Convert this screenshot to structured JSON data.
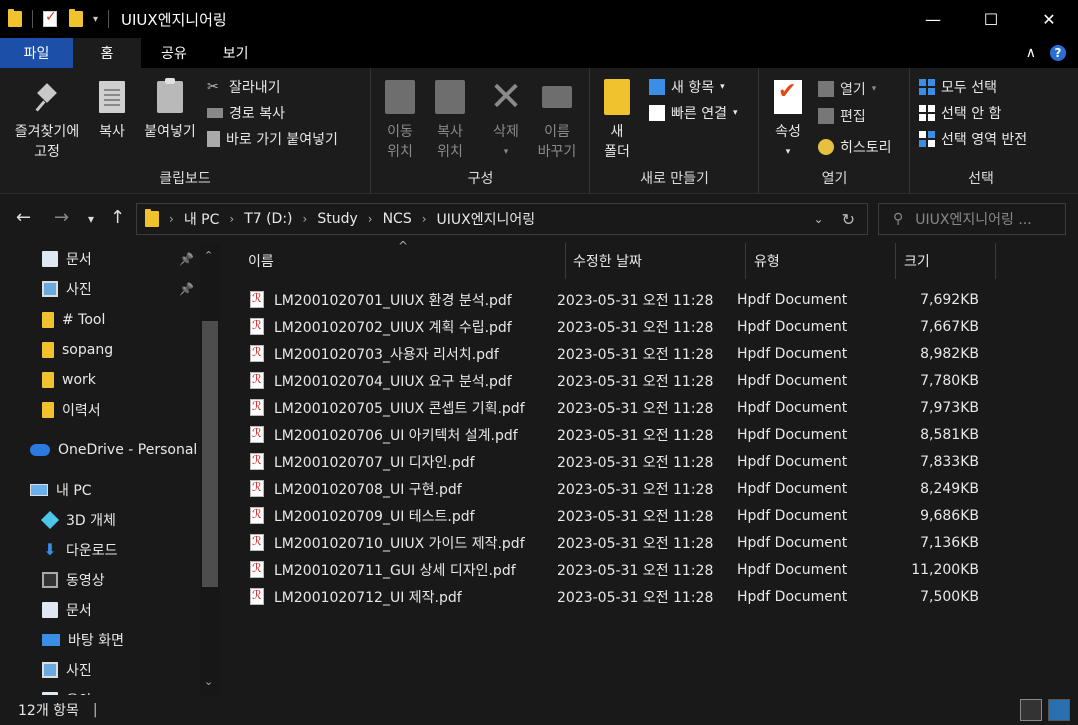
{
  "window": {
    "title": "UIUX엔지니어링",
    "minimize": "—",
    "maximize": "☐",
    "close": "✕"
  },
  "tabs": {
    "file": "파일",
    "home": "홈",
    "share": "공유",
    "view": "보기",
    "collapse": "∧",
    "help": "?"
  },
  "ribbon": {
    "clipboard": {
      "label": "클립보드",
      "pin": [
        "즐겨찾기에",
        "고정"
      ],
      "copy": "복사",
      "paste": "붙여넣기",
      "cut": "잘라내기",
      "copy_path": "경로 복사",
      "paste_shortcut": "바로 가기 붙여넣기"
    },
    "organize": {
      "label": "구성",
      "move_to": [
        "이동",
        "위치"
      ],
      "copy_to": [
        "복사",
        "위치"
      ],
      "delete": "삭제",
      "rename": [
        "이름",
        "바꾸기"
      ]
    },
    "new": {
      "label": "새로 만들기",
      "new_folder": [
        "새",
        "폴더"
      ],
      "new_item": "새 항목",
      "easy_access": "빠른 연결"
    },
    "open": {
      "label": "열기",
      "properties": "속성",
      "open": "열기",
      "edit": "편집",
      "history": "히스토리"
    },
    "select": {
      "label": "선택",
      "select_all": "모두 선택",
      "select_none": "선택 안 함",
      "invert": "선택 영역 반전"
    }
  },
  "address": {
    "crumbs": [
      "내 PC",
      "T7 (D:)",
      "Study",
      "NCS",
      "UIUX엔지니어링"
    ],
    "search_placeholder": "UIUX엔지니어링 ..."
  },
  "nav": [
    {
      "label": "문서",
      "icon": "document-icon",
      "pinned": true
    },
    {
      "label": "사진",
      "icon": "pictures-icon",
      "pinned": true
    },
    {
      "label": "# Tool",
      "icon": "folder-icon",
      "pinned": false
    },
    {
      "label": "sopang",
      "icon": "folder-icon",
      "pinned": false
    },
    {
      "label": "work",
      "icon": "folder-icon",
      "pinned": false
    },
    {
      "label": "이력서",
      "icon": "folder-icon",
      "pinned": false
    },
    {
      "label": "OneDrive - Personal",
      "icon": "cloud-icon",
      "pinned": false
    },
    {
      "label": "내 PC",
      "icon": "pc-icon",
      "pinned": false
    },
    {
      "label": "3D 개체",
      "icon": "cube-icon",
      "pinned": false
    },
    {
      "label": "다운로드",
      "icon": "download-icon",
      "pinned": false
    },
    {
      "label": "동영상",
      "icon": "video-icon",
      "pinned": false
    },
    {
      "label": "문서",
      "icon": "document-icon",
      "pinned": false
    },
    {
      "label": "바탕 화면",
      "icon": "desktop-icon",
      "pinned": false
    },
    {
      "label": "사진",
      "icon": "pictures-icon",
      "pinned": false
    },
    {
      "label": "음악",
      "icon": "music-icon",
      "pinned": false
    }
  ],
  "columns": {
    "name": "이름",
    "date": "수정한 날짜",
    "type": "유형",
    "size": "크기"
  },
  "files": [
    {
      "name": "LM2001020701_UIUX 환경 분석.pdf",
      "date": "2023-05-31 오전 11:28",
      "type": "Hpdf Document",
      "size": "7,692KB"
    },
    {
      "name": "LM2001020702_UIUX 계획 수립.pdf",
      "date": "2023-05-31 오전 11:28",
      "type": "Hpdf Document",
      "size": "7,667KB"
    },
    {
      "name": "LM2001020703_사용자 리서치.pdf",
      "date": "2023-05-31 오전 11:28",
      "type": "Hpdf Document",
      "size": "8,982KB"
    },
    {
      "name": "LM2001020704_UIUX 요구 분석.pdf",
      "date": "2023-05-31 오전 11:28",
      "type": "Hpdf Document",
      "size": "7,780KB"
    },
    {
      "name": "LM2001020705_UIUX 콘셉트 기획.pdf",
      "date": "2023-05-31 오전 11:28",
      "type": "Hpdf Document",
      "size": "7,973KB"
    },
    {
      "name": "LM2001020706_UI 아키텍처 설계.pdf",
      "date": "2023-05-31 오전 11:28",
      "type": "Hpdf Document",
      "size": "8,581KB"
    },
    {
      "name": "LM2001020707_UI 디자인.pdf",
      "date": "2023-05-31 오전 11:28",
      "type": "Hpdf Document",
      "size": "7,833KB"
    },
    {
      "name": "LM2001020708_UI 구현.pdf",
      "date": "2023-05-31 오전 11:28",
      "type": "Hpdf Document",
      "size": "8,249KB"
    },
    {
      "name": "LM2001020709_UI 테스트.pdf",
      "date": "2023-05-31 오전 11:28",
      "type": "Hpdf Document",
      "size": "9,686KB"
    },
    {
      "name": "LM2001020710_UIUX 가이드 제작.pdf",
      "date": "2023-05-31 오전 11:28",
      "type": "Hpdf Document",
      "size": "7,136KB"
    },
    {
      "name": "LM2001020711_GUI 상세 디자인.pdf",
      "date": "2023-05-31 오전 11:28",
      "type": "Hpdf Document",
      "size": "11,200KB"
    },
    {
      "name": "LM2001020712_UI 제작.pdf",
      "date": "2023-05-31 오전 11:28",
      "type": "Hpdf Document",
      "size": "7,500KB"
    }
  ],
  "status": {
    "count": "12개 항목"
  }
}
